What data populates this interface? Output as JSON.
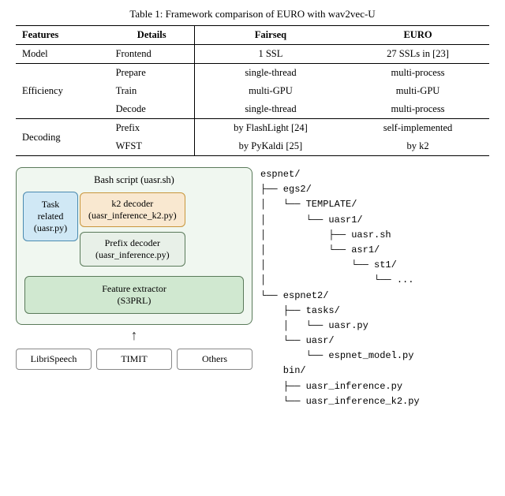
{
  "table": {
    "title": "Table 1: Framework comparison of EURO with wav2vec-U",
    "headers": [
      "Features",
      "Details",
      "Fairseq",
      "EURO"
    ],
    "rows": [
      {
        "feature": "Model",
        "details": [
          "Frontend"
        ],
        "fairseq": [
          "1 SSL"
        ],
        "euro": [
          "27 SSLs in [23]"
        ]
      },
      {
        "feature": "Efficiency",
        "details": [
          "Prepare",
          "Train",
          "Decode"
        ],
        "fairseq": [
          "single-thread",
          "multi-GPU",
          "single-thread"
        ],
        "euro": [
          "multi-process",
          "multi-GPU",
          "multi-process"
        ]
      },
      {
        "feature": "Decoding",
        "details": [
          "Prefix",
          "WFST"
        ],
        "fairseq": [
          "by FlashLight [24]",
          "by PyKaldi [25]"
        ],
        "euro": [
          "self-implemented",
          "by k2"
        ]
      }
    ]
  },
  "diagram": {
    "bash_title": "Bash script (uasr.sh)",
    "task_box": "Task related\n(uasr.py)",
    "k2_decoder": "k2 decoder\n(uasr_inference_k2.py)",
    "prefix_decoder": "Prefix decoder\n(uasr_inference.py)",
    "feature_extractor": "Feature extractor\n(S3PRL)",
    "datasets": [
      "LibriSpeech",
      "TIMIT",
      "Others"
    ]
  },
  "tree": {
    "lines": [
      "espnet/",
      "├── egs2/",
      "│   └── TEMPLATE/",
      "│       └── uasr1/",
      "│           ├── uasr.sh",
      "│           └── asr1/",
      "│               └── st1/",
      "│                   └── ...",
      "└── espnet2/",
      "    ├── tasks/",
      "    │   └── uasr.py",
      "    └── uasr/",
      "        └── espnet_model.py",
      "    bin/",
      "    ├── uasr_inference.py",
      "    └── uasr_inference_k2.py"
    ]
  }
}
